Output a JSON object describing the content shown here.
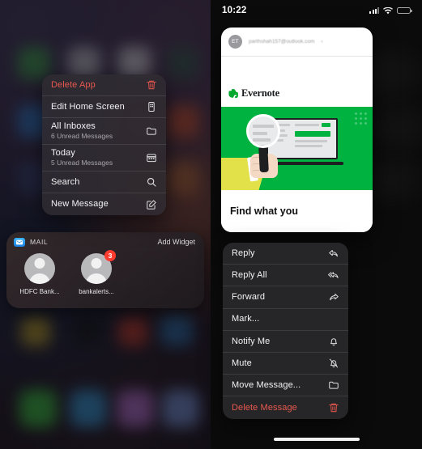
{
  "left_screen": {
    "context_menu": {
      "items": [
        {
          "label": "Delete App",
          "sub": null,
          "icon": "trash-icon",
          "destructive": true
        },
        {
          "label": "Edit Home Screen",
          "sub": null,
          "icon": "edit-home-screen-icon",
          "destructive": false
        },
        {
          "label": "All Inboxes",
          "sub": "6 Unread Messages",
          "icon": "folder-icon",
          "destructive": false
        },
        {
          "label": "Today",
          "sub": "5 Unread Messages",
          "icon": "calendar-icon",
          "destructive": false
        },
        {
          "label": "Search",
          "sub": null,
          "icon": "search-icon",
          "destructive": false
        },
        {
          "label": "New Message",
          "sub": null,
          "icon": "compose-icon",
          "destructive": false
        }
      ]
    },
    "widget": {
      "app_icon": "mail-app-icon",
      "title": "MAIL",
      "add_widget_label": "Add Widget",
      "contacts": [
        {
          "name": "HDFC Bank...",
          "badge": null
        },
        {
          "name": "bankalerts...",
          "badge": "3"
        }
      ]
    }
  },
  "right_screen": {
    "status_bar": {
      "time": "10:22",
      "signal_icon": "cellular-signal-icon",
      "wifi_icon": "wifi-icon",
      "battery_icon": "battery-icon"
    },
    "email_card": {
      "avatar_initials": "ET",
      "sender_address": "parthshah157@outlook.com",
      "disclosure": "›",
      "brand_name": "Evernote",
      "headline": "Find what you"
    },
    "context_menu": {
      "items": [
        {
          "label": "Reply",
          "icon": "reply-icon",
          "destructive": false
        },
        {
          "label": "Reply All",
          "icon": "reply-all-icon",
          "destructive": false
        },
        {
          "label": "Forward",
          "icon": "forward-icon",
          "destructive": false
        },
        {
          "label": "Mark...",
          "icon": null,
          "destructive": false
        },
        {
          "label": "Notify Me",
          "icon": "bell-icon",
          "destructive": false
        },
        {
          "label": "Mute",
          "icon": "bell-slash-icon",
          "destructive": false
        },
        {
          "label": "Move Message...",
          "icon": "folder-icon",
          "destructive": false
        },
        {
          "label": "Delete Message",
          "icon": "trash-icon",
          "destructive": true
        }
      ]
    }
  },
  "colors": {
    "destructive": "#e8584f",
    "badge": "#ff3b30",
    "evernote_green": "#00b341",
    "menu_background": "#282829"
  }
}
